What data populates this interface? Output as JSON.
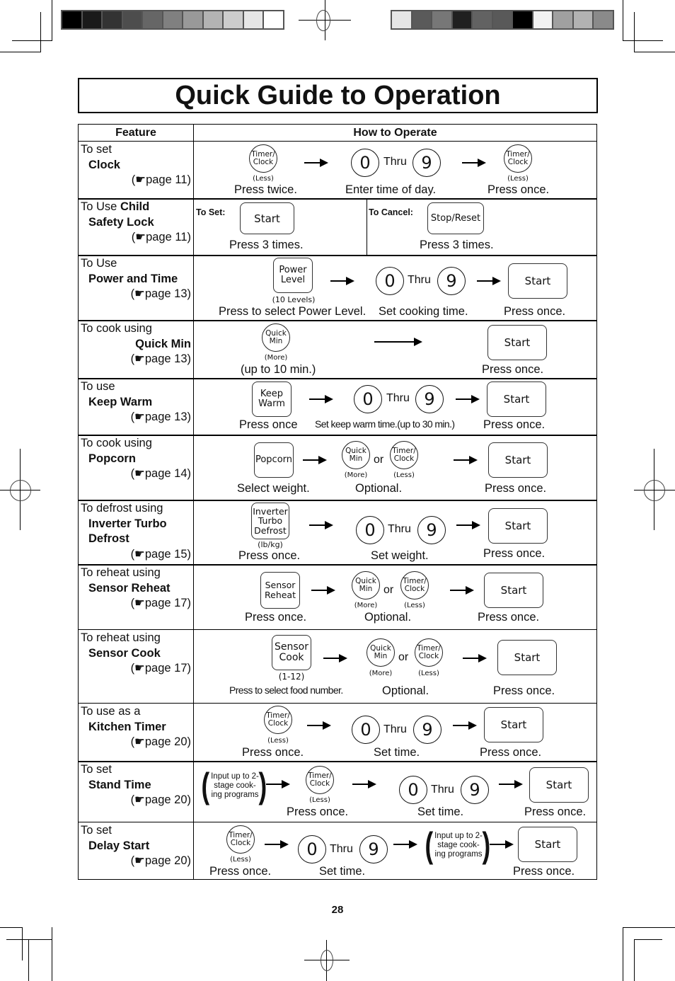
{
  "page": {
    "title": "Quick Guide to Operation",
    "page_number": "28",
    "calibration_left": [
      "#000000",
      "#1a1a1a",
      "#333333",
      "#4d4d4d",
      "#666666",
      "#808080",
      "#999999",
      "#b3b3b3",
      "#cccccc",
      "#e6e6e6",
      "#ffffff"
    ],
    "calibration_right": [
      "#e6e6e6",
      "#5a5a5a",
      "#777777",
      "#202020",
      "#626262",
      "#595959",
      "#000000",
      "#f2f2f2",
      "#a0a0a0",
      "#b2b2b2",
      "#8a8a8a"
    ]
  },
  "table": {
    "header_feature": "Feature",
    "header_how": "How to Operate",
    "rows": [
      {
        "f1": "To set",
        "f2": "Clock",
        "pg": "(☛page 11)"
      },
      {
        "f1": "To Use",
        "f1b": "Child",
        "f2": "Safety Lock",
        "pg": "(☛page 11)"
      },
      {
        "f1": "To Use",
        "f2": "Power and Time",
        "pg": "(☛page 13)"
      },
      {
        "f1": "To cook using",
        "f2": "Quick Min",
        "pg": "(☛page 13)"
      },
      {
        "f1": "To use",
        "f2": "Keep Warm",
        "pg": "(☛page 13)"
      },
      {
        "f1": "To cook using",
        "f2": "Popcorn",
        "pg": "(☛page 14)"
      },
      {
        "f1": "To defrost using",
        "f2": "Inverter Turbo",
        "f3": "Defrost",
        "pg": "(☛page 15)"
      },
      {
        "f1": "To reheat using",
        "f2": "Sensor Reheat",
        "pg": "(☛page 17)"
      },
      {
        "f1": "To reheat using",
        "f2": "Sensor Cook",
        "pg": "(☛page 17)"
      },
      {
        "f1": "To use as a",
        "f2": "Kitchen Timer",
        "pg": "(☛page 20)"
      },
      {
        "f1": "To set",
        "f2": "Stand Time",
        "pg": "(☛page 20)"
      },
      {
        "f1": "To set",
        "f2": "Delay Start",
        "pg": "(☛page 20)"
      }
    ]
  },
  "keys": {
    "timer_top": "Timer/",
    "timer_bot": "Clock",
    "less": "(Less)",
    "quick_top": "Quick",
    "quick_bot": "Min",
    "more": "(More)",
    "start": "Start",
    "stop_reset": "Stop/Reset",
    "power_top": "Power",
    "power_bot": "Level",
    "ten_levels": "(10 Levels)",
    "keep_top": "Keep",
    "keep_bot": "Warm",
    "popcorn": "Popcorn",
    "inv1": "Inverter",
    "inv2": "Turbo",
    "inv3": "Defrost",
    "lbkg": "(lb/kg)",
    "sr_top": "Sensor",
    "sr_bot": "Reheat",
    "sc_top": "Sensor",
    "sc_bot": "Cook",
    "one_twelve": "(1-12)",
    "zero": "0",
    "nine": "9",
    "thru": "Thru",
    "or": "or",
    "two_stage": "Input up to 2-stage cook-ing programs",
    "lp": "(",
    "rp": ")"
  },
  "captions": {
    "press_twice": "Press twice.",
    "enter_time_of_day": "Enter time of day.",
    "press_once": "Press once.",
    "press_once_nodot": "Press once",
    "press_3_times": "Press 3 times.",
    "to_set": "To Set:",
    "to_cancel": "To Cancel:",
    "select_power": "Press to select Power Level.",
    "set_cooking_time": "Set cooking time.",
    "up_to_10": "(up to 10 min.)",
    "keep_warm_time": "Set keep warm time.(up to 30 min.)",
    "select_weight": "Select weight.",
    "optional": "Optional.",
    "set_weight": "Set weight.",
    "select_food": "Press to select food number.",
    "set_time": "Set time."
  }
}
